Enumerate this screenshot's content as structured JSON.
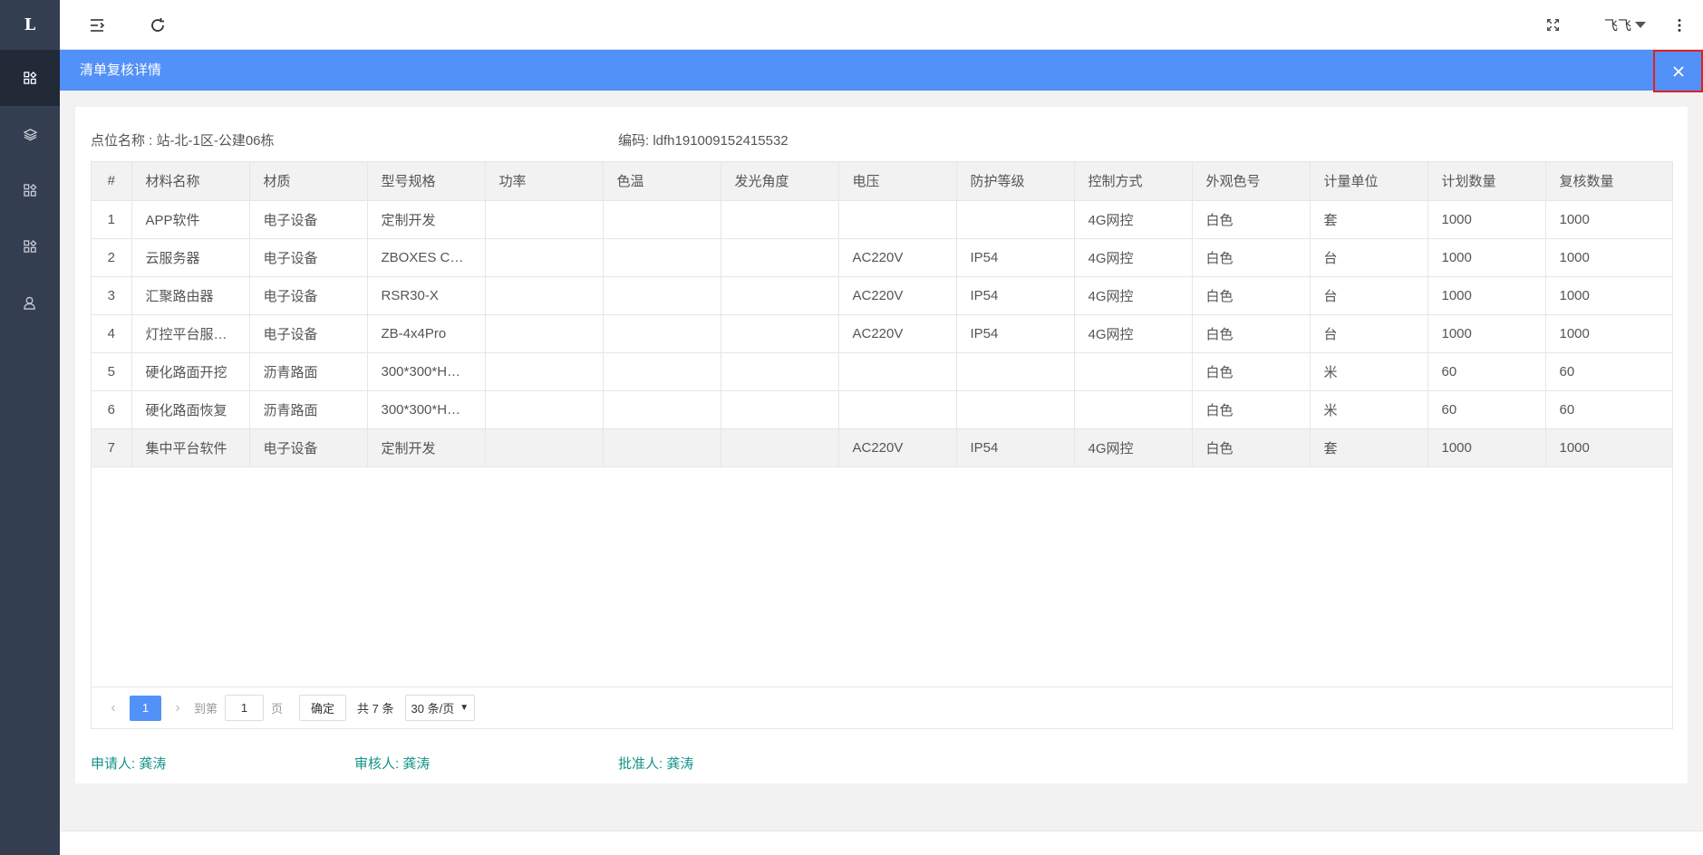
{
  "sidebar": {
    "logo": "L",
    "items": [
      {
        "icon": "app-grid-icon",
        "active": true
      },
      {
        "icon": "layers-icon",
        "active": false
      },
      {
        "icon": "app-grid-icon",
        "active": false
      },
      {
        "icon": "app-grid-icon",
        "active": false
      },
      {
        "icon": "user-icon",
        "active": false
      }
    ]
  },
  "header": {
    "menu_icon": "menu-toggle-icon",
    "refresh_icon": "refresh-icon",
    "fullscreen_icon": "fullscreen-icon",
    "user_name": "飞飞",
    "more_icon": "more-vertical-icon"
  },
  "dialog": {
    "title": "清单复核详情",
    "close_icon": "close-icon"
  },
  "info": {
    "location": "点位名称 : 站-北-1区-公建06栋",
    "code": "编码: ldfh191009152415532"
  },
  "table": {
    "columns": [
      "#",
      "材料名称",
      "材质",
      "型号规格",
      "功率",
      "色温",
      "发光角度",
      "电压",
      "防护等级",
      "控制方式",
      "外观色号",
      "计量单位",
      "计划数量",
      "复核数量"
    ],
    "rows": [
      [
        "1",
        "APP软件",
        "电子设备",
        "定制开发",
        "",
        "",
        "",
        "",
        "",
        "4G网控",
        "白色",
        "套",
        "1000",
        "1000"
      ],
      [
        "2",
        "云服务器",
        "电子设备",
        "ZBOXES C…",
        "",
        "",
        "",
        "AC220V",
        "IP54",
        "4G网控",
        "白色",
        "台",
        "1000",
        "1000"
      ],
      [
        "3",
        "汇聚路由器",
        "电子设备",
        "RSR30-X",
        "",
        "",
        "",
        "AC220V",
        "IP54",
        "4G网控",
        "白色",
        "台",
        "1000",
        "1000"
      ],
      [
        "4",
        "灯控平台服…",
        "电子设备",
        "ZB-4x4Pro",
        "",
        "",
        "",
        "AC220V",
        "IP54",
        "4G网控",
        "白色",
        "台",
        "1000",
        "1000"
      ],
      [
        "5",
        "硬化路面开挖",
        "沥青路面",
        "300*300*H…",
        "",
        "",
        "",
        "",
        "",
        "",
        "白色",
        "米",
        "60",
        "60"
      ],
      [
        "6",
        "硬化路面恢复",
        "沥青路面",
        "300*300*H…",
        "",
        "",
        "",
        "",
        "",
        "",
        "白色",
        "米",
        "60",
        "60"
      ],
      [
        "7",
        "集中平台软件",
        "电子设备",
        "定制开发",
        "",
        "",
        "",
        "AC220V",
        "IP54",
        "4G网控",
        "白色",
        "套",
        "1000",
        "1000"
      ]
    ],
    "highlighted_row": 7
  },
  "pager": {
    "prev": "‹",
    "current_page": "1",
    "next": "›",
    "goto_label": "到第",
    "goto_value": "1",
    "page_label": "页",
    "confirm": "确定",
    "total": "共 7 条",
    "page_size": "30 条/页",
    "page_size_arrow": "▼"
  },
  "signers": {
    "applicant": "申请人: 龚涛",
    "reviewer": "审核人: 龚涛",
    "approver": "批准人: 龚涛"
  }
}
